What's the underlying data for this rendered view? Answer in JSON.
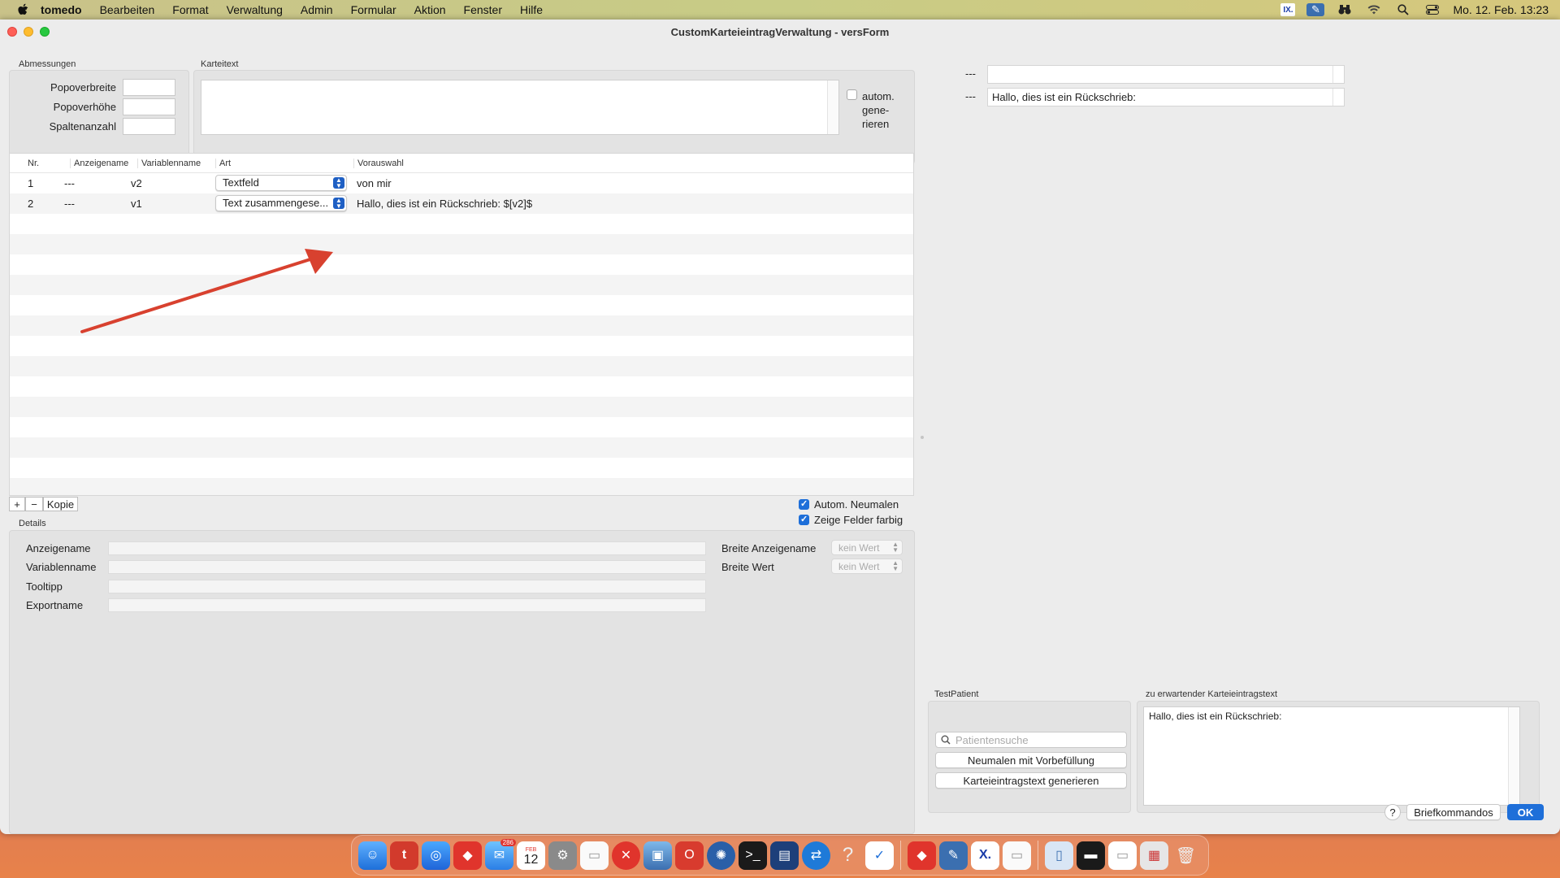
{
  "menubar": {
    "app": "tomedo",
    "items": [
      "Bearbeiten",
      "Format",
      "Verwaltung",
      "Admin",
      "Formular",
      "Aktion",
      "Fenster",
      "Hilfe"
    ],
    "ix_label": "IX.",
    "clock": "Mo. 12. Feb.  13:23"
  },
  "window": {
    "title": "CustomKarteieintragVerwaltung - versForm"
  },
  "abmessungen": {
    "label": "Abmessungen",
    "popoverbreite": "Popoverbreite",
    "popoverhoehe": "Popoverhöhe",
    "spaltenanzahl": "Spaltenanzahl"
  },
  "karteitext": {
    "label": "Karteitext",
    "auto_line1": "autom.",
    "auto_line2": "gene-",
    "auto_line3": "rieren"
  },
  "table": {
    "headers": {
      "nr": "Nr.",
      "anzeigename": "Anzeigename",
      "variablenname": "Variablenname",
      "art": "Art",
      "vorauswahl": "Vorauswahl"
    },
    "rows": [
      {
        "nr": "1",
        "anzeigename": "---",
        "variablenname": "v2",
        "art": "Textfeld",
        "vorauswahl": "von mir"
      },
      {
        "nr": "2",
        "anzeigename": "---",
        "variablenname": "v1",
        "art": "Text zusammengese...",
        "vorauswahl": "Hallo, dies ist ein Rückschrieb:  $[v2]$"
      }
    ]
  },
  "table_controls": {
    "add": "+",
    "remove": "−",
    "copy": "Kopie",
    "auto_neumalen": "Autom. Neumalen",
    "zeige_farbig": "Zeige Felder farbig"
  },
  "details": {
    "label": "Details",
    "anzeigename": "Anzeigename",
    "variablenname": "Variablenname",
    "tooltipp": "Tooltipp",
    "exportname": "Exportname",
    "breite_anzeigename": "Breite Anzeigename",
    "breite_wert": "Breite Wert",
    "kein_wert": "kein Wert"
  },
  "preview": {
    "row1_label": "---",
    "row1_value": "",
    "row2_label": "---",
    "row2_value": "Hallo, dies ist ein Rückschrieb:"
  },
  "testpatient": {
    "label": "TestPatient",
    "search_placeholder": "Patientensuche",
    "btn_neumalen": "Neumalen mit Vorbefüllung",
    "btn_generieren": "Karteieintragstext generieren"
  },
  "expected": {
    "label": "zu erwartender Karteieintragstext",
    "text": "Hallo, dies ist ein Rückschrieb:"
  },
  "footer": {
    "help": "?",
    "briefkommandos": "Briefkommandos",
    "ok": "OK"
  },
  "dock": {
    "mail_badge": "286",
    "calendar_month": "FEB",
    "calendar_day": "12"
  },
  "colors": {
    "accent": "#1e6fd9",
    "arrow": "#d8412f"
  }
}
